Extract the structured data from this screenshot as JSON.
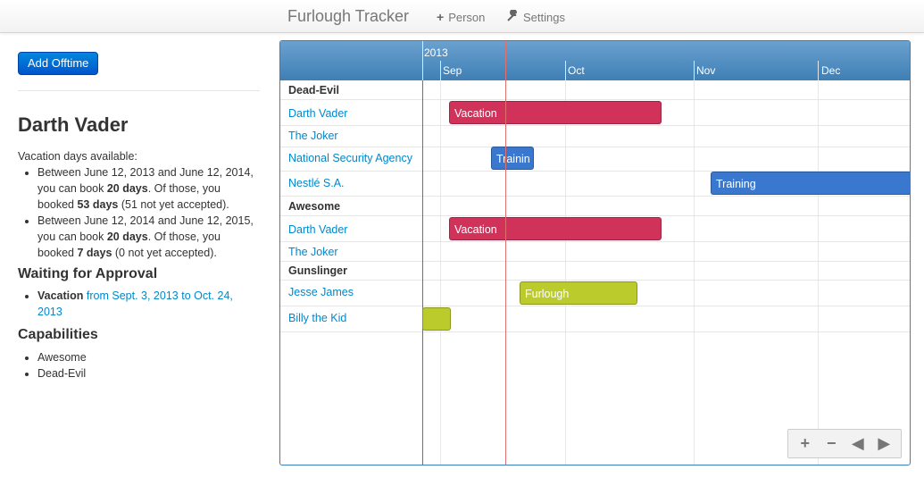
{
  "nav": {
    "brand": "Furlough Tracker",
    "person_icon": "plus-icon",
    "person_label": "Person",
    "settings_icon": "wrench-icon",
    "settings_label": "Settings"
  },
  "sidebar": {
    "add_button": "Add Offtime",
    "person_name": "Darth Vader",
    "vacation_title": "Vacation days available:",
    "periods": [
      {
        "pre": "Between June 12, 2013 and June 12, 2014, you can book ",
        "days": "20 days",
        "mid": ". Of those, you booked ",
        "booked": "53 days",
        "post": " (51 not yet accepted)."
      },
      {
        "pre": "Between June 12, 2014 and June 12, 2015, you can book ",
        "days": "20 days",
        "mid": ". Of those, you booked ",
        "booked": "7 days",
        "post": " (0 not yet accepted)."
      }
    ],
    "waiting_title": "Waiting for Approval",
    "waiting_items": [
      {
        "type": "Vacation",
        "range": "from Sept. 3, 2013 to Oct. 24, 2013"
      }
    ],
    "capabilities_title": "Capabilities",
    "capabilities": [
      "Awesome",
      "Dead-Evil"
    ]
  },
  "timeline": {
    "year": "2013",
    "months": [
      "Sep",
      "Oct",
      "Nov",
      "Dec"
    ],
    "rows": [
      {
        "label": "Dead-Evil",
        "kind": "group"
      },
      {
        "label": "Darth Vader",
        "kind": "item"
      },
      {
        "label": "The Joker",
        "kind": "item"
      },
      {
        "label": "National Security Agency",
        "kind": "item"
      },
      {
        "label": "Nestlé S.A.",
        "kind": "item"
      },
      {
        "label": "Awesome",
        "kind": "group"
      },
      {
        "label": "Darth Vader",
        "kind": "item"
      },
      {
        "label": "The Joker",
        "kind": "item"
      },
      {
        "label": "Gunslinger",
        "kind": "group"
      },
      {
        "label": "Jesse James",
        "kind": "item"
      },
      {
        "label": "Billy the Kid",
        "kind": "item"
      }
    ],
    "bars": [
      {
        "label": "Vacation",
        "color": "#d0325a"
      },
      {
        "label": "Trainin",
        "color": "#3a78cf"
      },
      {
        "label": "Training",
        "color": "#3a78cf"
      },
      {
        "label": "Vacation",
        "color": "#d0325a"
      },
      {
        "label": "Furlough",
        "color": "#bccb2c"
      },
      {
        "label": "",
        "color": "#bccb2c"
      }
    ],
    "zoom_controls": [
      "zoom-in-icon",
      "zoom-out-icon",
      "previous-icon",
      "next-icon"
    ]
  }
}
